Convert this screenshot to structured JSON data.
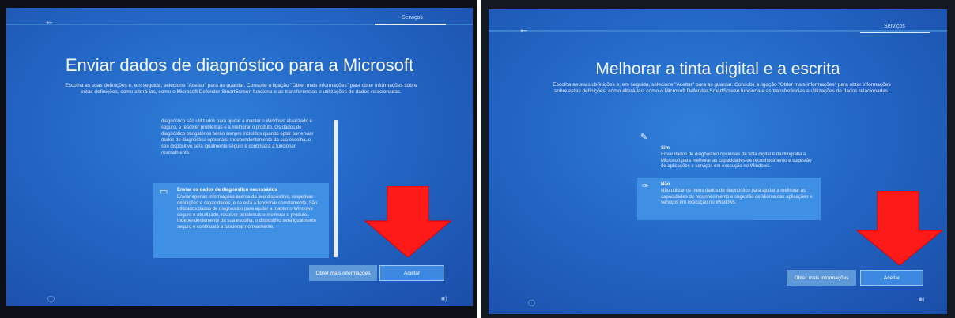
{
  "left": {
    "tab": "Serviços",
    "title": "Enviar dados de diagnóstico para a Microsoft",
    "subtitle": "Escolha as suas definições e, em seguida, selecione \"Aceitar\" para as guardar. Consulte a ligação \"Obter mais informações\" para obter informações sobre estas definições, como alterá-las, como o Microsoft Defender SmartScreen funciona e as transferências e utilizações de dados relacionadas.",
    "option_full_partial": "diagnóstico são utilizados para ajudar a manter o Windows atualizado e seguro, a resolver problemas e a melhorar o produto. Os dados de diagnóstico obrigatórios serão sempre incluídos quando optar por enviar dados de diagnóstico opcionais. Independentemente da sua escolha, o seu dispositivo será igualmente seguro e continuará a funcionar normalmente.",
    "option_required": {
      "title": "Enviar os dados de diagnóstico necessários",
      "description": "Enviar apenas informações acerca do seu dispositivo, respetivas definições e capacidades, e se está a funcionar corretamente. São utilizados dados de diagnóstico para ajudar a manter o Windows seguro e atualizado, resolver problemas e melhorar o produto. Independentemente da sua escolha, o dispositivo será igualmente seguro e continuará a funcionar normalmente."
    },
    "btn_more_info": "Obter mais informações",
    "btn_accept": "Aceitar"
  },
  "right": {
    "tab": "Serviços",
    "title": "Melhorar a tinta digital e a escrita",
    "subtitle": "Escolha as suas definições e, em seguida, selecione \"Aceitar\" para as guardar. Consulte a ligação \"Obter mais informações\" para obter informações sobre estas definições, como alterá-las, como o Microsoft Defender SmartScreen funciona e as transferências e utilizações de dados relacionadas.",
    "option_yes": {
      "title": "Sim",
      "description": "Envie dados de diagnóstico opcionais de tinta digital e dactilografia à Microsoft para melhorar as capacidades de reconhecimento e sugestão de aplicações e serviços em execução no Windows."
    },
    "option_no": {
      "title": "Não",
      "description": "Não utilizar os meus dados de diagnóstico para ajudar a melhorar as capacidades de reconhecimento e sugestão de idioma das aplicações e serviços em execução no Windows."
    },
    "btn_more_info": "Obter mais informações",
    "btn_accept": "Aceitar"
  },
  "icons": {
    "back": "back-arrow-icon",
    "required_option": "diagnostic-icon",
    "pen_yes": "pen-icon",
    "pen_no": "pen-off-icon",
    "accessibility": "accessibility-icon",
    "volume": "volume-icon",
    "annotation_arrow": "red-down-arrow"
  },
  "colors": {
    "oobe_blue": "#2467c6",
    "selected_option": "#3f8fe4",
    "annotation_red": "#ff1a1a"
  }
}
